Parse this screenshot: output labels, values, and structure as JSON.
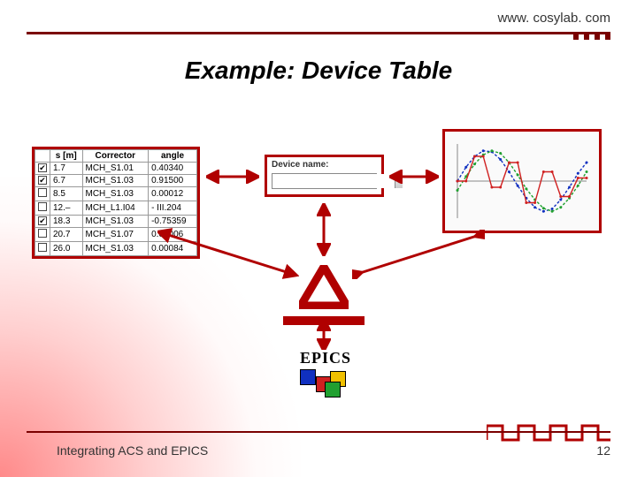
{
  "header": {
    "url": "www. cosylab. com"
  },
  "title": "Example: Device Table",
  "table": {
    "headers": [
      "",
      "s [m]",
      "Corrector",
      "angle"
    ],
    "rows": [
      {
        "checked": true,
        "s": "1.7",
        "corrector": "MCH_S1.01",
        "angle": "0.40340"
      },
      {
        "checked": true,
        "s": "6.7",
        "corrector": "MCH_S1.03",
        "angle": "0.91500"
      },
      {
        "checked": false,
        "s": "8.5",
        "corrector": "MCH_S1.03",
        "angle": "0.00012"
      },
      {
        "checked": false,
        "s": "12.–",
        "corrector": "MCH_L1.I04",
        "angle": "- III.204"
      },
      {
        "checked": true,
        "s": "18.3",
        "corrector": "MCH_S1.03",
        "angle": "-0.75359"
      },
      {
        "checked": false,
        "s": "20.7",
        "corrector": "MCH_S1.07",
        "angle": "0.00006"
      },
      {
        "checked": false,
        "s": "26.0",
        "corrector": "MCH_S1.03",
        "angle": "0.00084"
      }
    ]
  },
  "device_box": {
    "label": "Device name:",
    "value": ""
  },
  "epics": {
    "label": "EPICS",
    "colors": [
      "#1030c0",
      "#d02020",
      "#f0c000",
      "#20a030"
    ]
  },
  "chart_data": {
    "type": "line",
    "title": "",
    "xlim": [
      0,
      100
    ],
    "ylim": [
      -1.2,
      1.2
    ],
    "series": [
      {
        "name": "blue",
        "color": "#1030c0",
        "y": [
          0,
          0.45,
          0.8,
          0.98,
          0.95,
          0.7,
          0.3,
          -0.15,
          -0.55,
          -0.85,
          -0.98,
          -0.9,
          -0.6,
          -0.2,
          0.25,
          0.6
        ]
      },
      {
        "name": "green",
        "color": "#20a030",
        "y": [
          -0.3,
          0.15,
          0.55,
          0.85,
          0.98,
          0.9,
          0.6,
          0.2,
          -0.25,
          -0.6,
          -0.88,
          -0.98,
          -0.85,
          -0.55,
          -0.15,
          0.3
        ]
      },
      {
        "name": "red",
        "color": "#d02020",
        "y": [
          0,
          0,
          0.8,
          0.8,
          -0.2,
          -0.2,
          0.6,
          0.6,
          -0.7,
          -0.7,
          0.3,
          0.3,
          -0.5,
          -0.5,
          0.1,
          0.1
        ]
      }
    ]
  },
  "footer": {
    "text": "Integrating ACS and EPICS",
    "page": "12"
  },
  "colors": {
    "accent": "#b00000",
    "dark": "#7a0000"
  }
}
